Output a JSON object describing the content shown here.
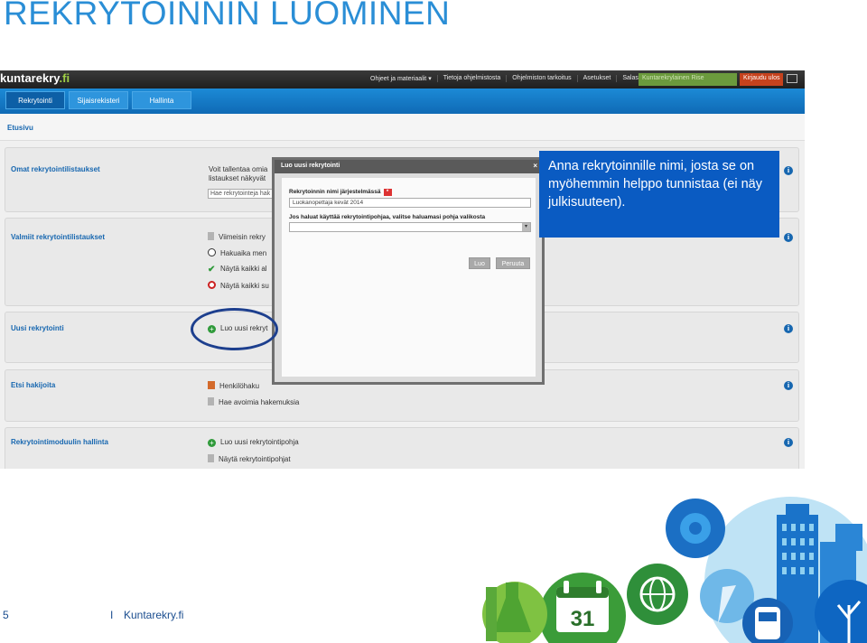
{
  "slide": {
    "title": "REKRYTOINNIN LUOMINEN",
    "page_number": "5",
    "separator": "I",
    "brand": "Kuntarekry.fi"
  },
  "app": {
    "logo_main": "kuntarekry",
    "logo_suffix": ".fi",
    "top_links": [
      "Ohjeet ja materiaalit ▾",
      "Tietoja ohjelmistosta",
      "Ohjelmiston tarkoitus",
      "Asetukset",
      "Salasana..."
    ],
    "user_label": "Kuntarekrylainen Rise",
    "logout_label": "Kirjaudu ulos",
    "nav_tabs": [
      "Rekrytointi",
      "Sijaisrekisteri",
      "Hallinta"
    ],
    "breadcrumb": "Etusivu"
  },
  "sections": {
    "omat": {
      "title": "Omat rekrytointilistaukset",
      "text1": "Voit tallentaa omia",
      "text2": "listaukset näkyvät",
      "input_placeholder": "Hae rekrytointeja hak"
    },
    "valmiit": {
      "title": "Valmiit rekrytointilistaukset",
      "items": [
        "Viimeisin rekry",
        "Hakuaika men",
        "Näytä kaikki al",
        "Näytä kaikki su"
      ]
    },
    "uusi": {
      "title": "Uusi rekrytointi",
      "item": "Luo uusi rekryt"
    },
    "etsi": {
      "title": "Etsi hakijoita",
      "items": [
        "Henkilöhaku",
        "Hae avoimia hakemuksia"
      ]
    },
    "hallinta": {
      "title": "Rekrytointimoduulin hallinta",
      "items": [
        "Luo uusi rekrytointipohja",
        "Näytä rekrytointipohjat"
      ]
    }
  },
  "modal": {
    "title": "Luo uusi rekrytointi",
    "close": "×",
    "name_label": "Rekrytoinnin nimi järjestelmässä",
    "required_mark": "*",
    "name_value": "Luokanopettaja kevät 2014",
    "template_label": "Jos haluat käyttää rekrytointipohjaa, valitse haluamasi pohja valikosta",
    "template_value": "",
    "create_button": "Luo",
    "cancel_button": "Peruuta"
  },
  "callout": {
    "text": "Anna rekrytoinnille nimi, josta se on myöhemmin helppo tunnistaa (ei näy julkisuuteen)."
  },
  "illustration": {
    "calendar_day": "31"
  },
  "colors": {
    "title_blue": "#2a8ed6",
    "nav_blue": "#1c8ad6",
    "callout_blue": "#0a5bc2",
    "link_blue": "#1767b0",
    "green": "#6b9a3d",
    "logout_red": "#c6421d"
  }
}
